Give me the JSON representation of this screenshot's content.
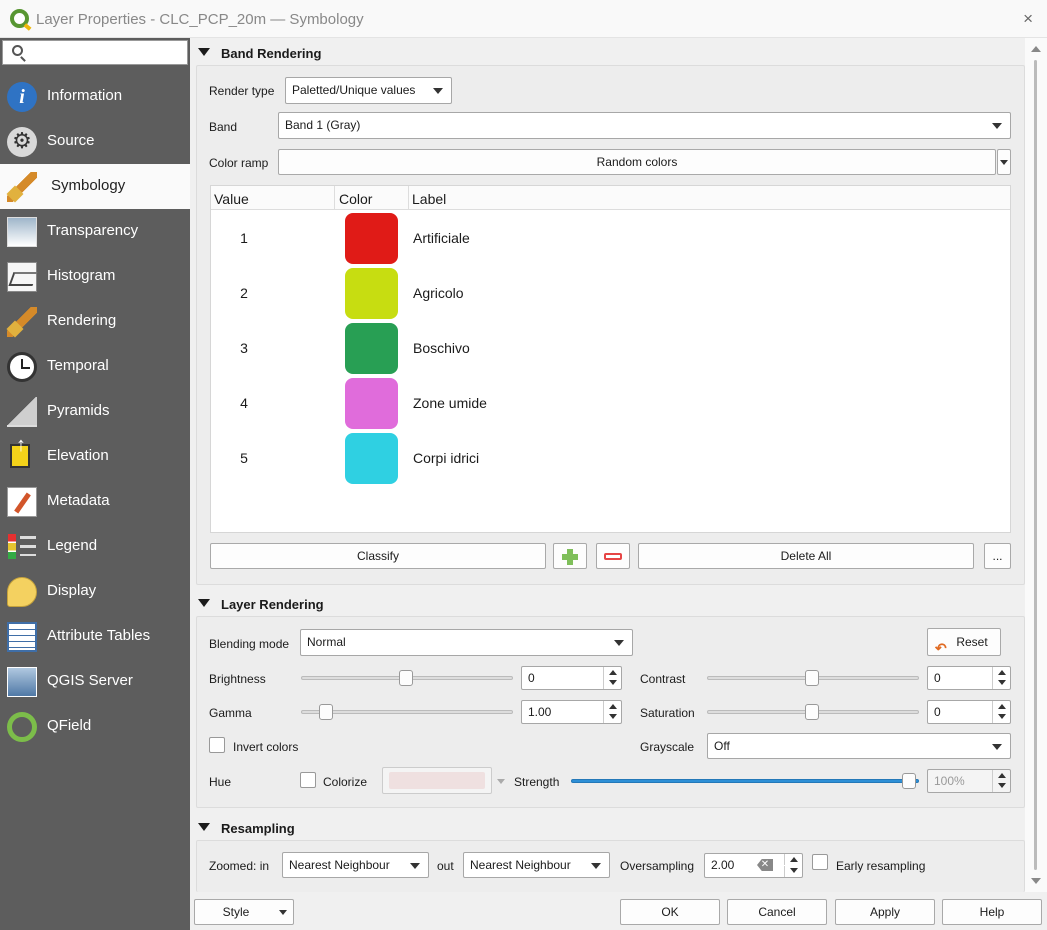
{
  "window": {
    "title": "Layer Properties - CLC_PCP_20m — Symbology",
    "close_icon": "×"
  },
  "search": {
    "placeholder": ""
  },
  "sidebar": {
    "items": [
      {
        "label": "Information",
        "icon": "information-icon"
      },
      {
        "label": "Source",
        "icon": "source-icon"
      },
      {
        "label": "Symbology",
        "icon": "symbology-icon",
        "active": true
      },
      {
        "label": "Transparency",
        "icon": "transparency-icon"
      },
      {
        "label": "Histogram",
        "icon": "histogram-icon"
      },
      {
        "label": "Rendering",
        "icon": "rendering-icon"
      },
      {
        "label": "Temporal",
        "icon": "temporal-icon"
      },
      {
        "label": "Pyramids",
        "icon": "pyramids-icon"
      },
      {
        "label": "Elevation",
        "icon": "elevation-icon"
      },
      {
        "label": "Metadata",
        "icon": "metadata-icon"
      },
      {
        "label": "Legend",
        "icon": "legend-icon"
      },
      {
        "label": "Display",
        "icon": "display-icon"
      },
      {
        "label": "Attribute Tables",
        "icon": "attribute-tables-icon"
      },
      {
        "label": "QGIS Server",
        "icon": "qgis-server-icon"
      },
      {
        "label": "QField",
        "icon": "qfield-icon"
      }
    ]
  },
  "band_rendering": {
    "title": "Band Rendering",
    "render_type_label": "Render type",
    "render_type_value": "Paletted/Unique values",
    "band_label": "Band",
    "band_value": "Band 1 (Gray)",
    "color_ramp_label": "Color ramp",
    "color_ramp_value": "Random colors",
    "columns": {
      "value": "Value",
      "color": "Color",
      "label": "Label"
    },
    "rows": [
      {
        "value": "1",
        "color": "#e01b17",
        "label": "Artificiale"
      },
      {
        "value": "2",
        "color": "#c7dd11",
        "label": "Agricolo"
      },
      {
        "value": "3",
        "color": "#289f54",
        "label": "Boschivo"
      },
      {
        "value": "4",
        "color": "#e06cdb",
        "label": "Zone umide"
      },
      {
        "value": "5",
        "color": "#2fd0e2",
        "label": "Corpi idrici"
      }
    ],
    "classify_label": "Classify",
    "delete_all_label": "Delete All",
    "more_label": "..."
  },
  "layer_rendering": {
    "title": "Layer Rendering",
    "blending_mode_label": "Blending mode",
    "blending_mode_value": "Normal",
    "reset_label": "Reset",
    "brightness_label": "Brightness",
    "brightness_value": "0",
    "contrast_label": "Contrast",
    "contrast_value": "0",
    "gamma_label": "Gamma",
    "gamma_value": "1.00",
    "saturation_label": "Saturation",
    "saturation_value": "0",
    "invert_colors_label": "Invert colors",
    "grayscale_label": "Grayscale",
    "grayscale_value": "Off",
    "hue_label": "Hue",
    "colorize_label": "Colorize",
    "strength_label": "Strength",
    "strength_value": "100%"
  },
  "resampling": {
    "title": "Resampling",
    "zoomed_in_label": "Zoomed: in",
    "zoomed_in_value": "Nearest Neighbour",
    "out_label": "out",
    "zoomed_out_value": "Nearest Neighbour",
    "oversampling_label": "Oversampling",
    "oversampling_value": "2.00",
    "early_resampling_label": "Early resampling"
  },
  "footer": {
    "style_label": "Style",
    "ok_label": "OK",
    "cancel_label": "Cancel",
    "apply_label": "Apply",
    "help_label": "Help"
  }
}
